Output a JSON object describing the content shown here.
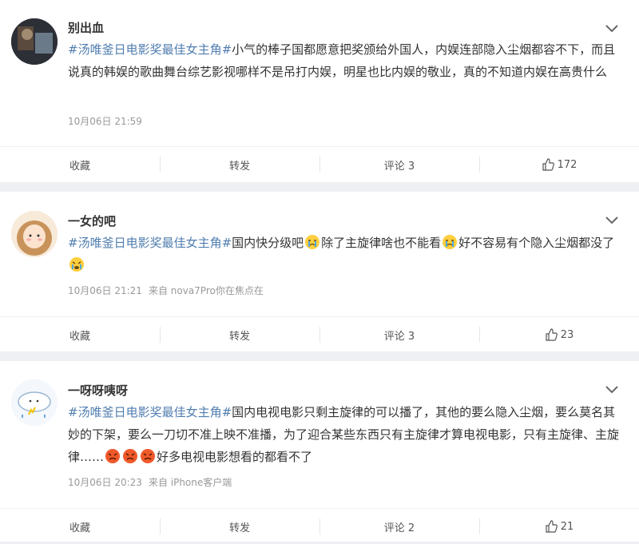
{
  "topic": "#汤唯釜日电影奖最佳女主角#",
  "posts": [
    {
      "user": "别出血",
      "text": "小气的棒子国都愿意把奖颁给外国人，内娱连部隐入尘烟都容不下，而且说真的韩娱的歌曲舞台综艺影视哪样不是吊打内娱，明星也比内娱的敬业，真的不知道内娱在高贵什么",
      "time": "10月06日 21:59",
      "source": "",
      "actions": {
        "collect": "收藏",
        "repost": "转发",
        "comment": "评论 3",
        "like": "172"
      }
    },
    {
      "user": "一女的吧",
      "text_parts": [
        "国内快分级吧",
        "除了主旋律啥也不能看",
        "好不容易有个隐入尘烟都没了"
      ],
      "emojis": [
        "cry-emoji",
        "cry-emoji",
        "sob-emoji"
      ],
      "time": "10月06日 21:21",
      "source": "来自 nova7Pro你在焦点在",
      "actions": {
        "collect": "收藏",
        "repost": "转发",
        "comment": "评论 3",
        "like": "23"
      }
    },
    {
      "user": "一呀呀咦呀",
      "text_parts": [
        "国内电视电影只剩主旋律的可以播了，其他的要么隐入尘烟，要么莫名其妙的下架，要么一刀切不准上映不准播，为了迎合某些东西只有主旋律才算电视电影，只有主旋律、主旋律……",
        "好多电视电影想看的都看不了"
      ],
      "emojis": [
        "angry-emoji",
        "angry-emoji",
        "angry-emoji"
      ],
      "time": "10月06日 20:23",
      "source": "来自 iPhone客户端",
      "actions": {
        "collect": "收藏",
        "repost": "转发",
        "comment": "评论 2",
        "like": "21"
      }
    }
  ],
  "icons": {
    "chevron": "chevron-down-icon",
    "like": "thumb-up-icon"
  },
  "colors": {
    "topic": "#507daf",
    "meta": "#999999",
    "background": "#eef0f3"
  }
}
